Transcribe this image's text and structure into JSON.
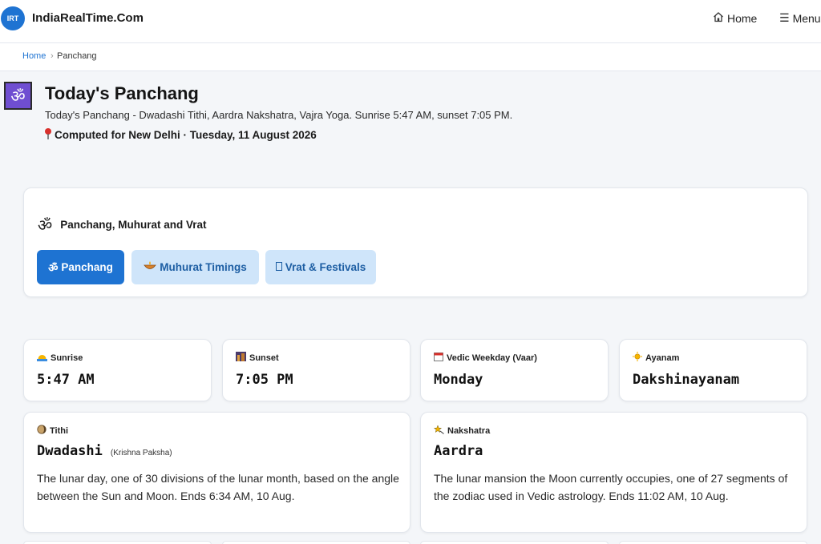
{
  "header": {
    "logo_badge": "IRT",
    "site_name": "IndiaRealTime.Com",
    "nav": {
      "home_label": "Home",
      "menu_label": "Menu",
      "home_icon": "house-icon",
      "menu_icon": "hamburger-icon"
    }
  },
  "breadcrumb": {
    "home": "Home",
    "separator": "›",
    "current": "Panchang"
  },
  "page": {
    "icon": "om-icon",
    "title": "Today's Panchang",
    "subtitle": "Today's Panchang - Dwadashi Tithi, Aardra Nakshatra, Vajra Yoga. Sunrise 5:47 AM, sunset 7:05 PM.",
    "computed": "Computed for New Delhi · Tuesday, 11 August 2026",
    "computed_icon": "pin-icon"
  },
  "tabs_section": {
    "heading": "Panchang, Muhurat and Vrat",
    "heading_icon": "om-icon",
    "tabs": [
      {
        "label": "Panchang",
        "icon": "om-icon",
        "active": true
      },
      {
        "label": "Muhurat Timings",
        "icon": "diya-icon",
        "active": false
      },
      {
        "label": "Vrat & Festivals",
        "icon": "calendar-icon",
        "active": false
      }
    ]
  },
  "summary_cards": [
    {
      "label": "Sunrise",
      "value": "5:47 AM",
      "icon": "sunrise-icon"
    },
    {
      "label": "Sunset",
      "value": "7:05 PM",
      "icon": "sunset-icon"
    },
    {
      "label": "Vedic Weekday (Vaar)",
      "value": "Monday",
      "icon": "calendar-icon"
    },
    {
      "label": "Ayanam",
      "value": "Dakshinayanam",
      "icon": "sun-icon"
    }
  ],
  "detail_cards": [
    {
      "label": "Tithi",
      "icon": "moon-phase-icon",
      "value": "Dwadashi",
      "qualifier": "(Krishna Paksha)",
      "description": "The lunar day, one of 30 divisions of the lunar month, based on the angle between the Sun and Moon. Ends 6:34 AM, 10 Aug."
    },
    {
      "label": "Nakshatra",
      "icon": "star-icon",
      "value": "Aardra",
      "qualifier": "",
      "description": "The lunar mansion the Moon currently occupies, one of 27 segments of the zodiac used in Vedic astrology. Ends 11:02 AM, 10 Aug."
    }
  ],
  "colors": {
    "accent": "#1e73d2",
    "tab_inactive_bg": "#cfe5fa",
    "page_bg": "#f4f6f9",
    "om_box": "#6f4ed1"
  }
}
